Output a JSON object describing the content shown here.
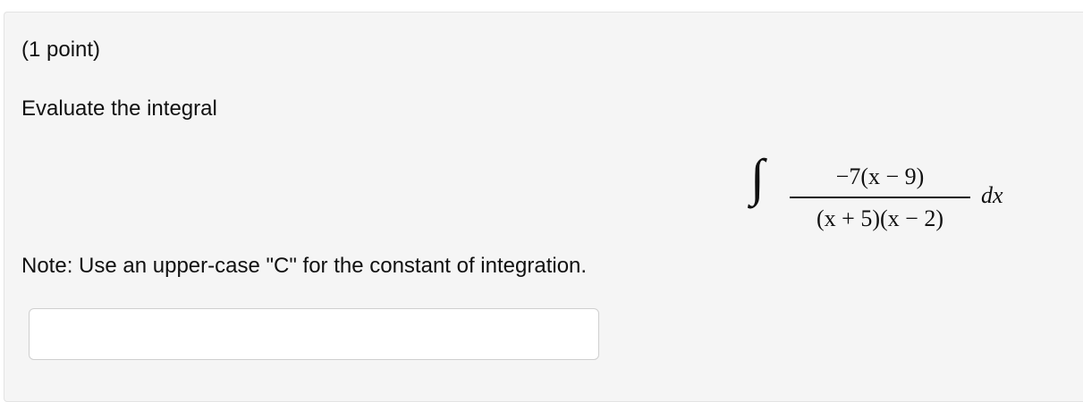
{
  "problem": {
    "points_text": "(1 point)",
    "prompt_text": "Evaluate the integral",
    "integral": {
      "sign": "∫",
      "numerator": "−7(x − 9)",
      "denominator": "(x + 5)(x − 2)",
      "differential": "dx"
    },
    "note_text": "Note: Use an upper-case \"C\" for the constant of integration.",
    "answer": {
      "value": "",
      "placeholder": ""
    }
  },
  "colors": {
    "panel_background": "#f5f5f5",
    "panel_border": "#e3e3e3",
    "input_border": "#cfcfcf",
    "text": "#111111"
  }
}
